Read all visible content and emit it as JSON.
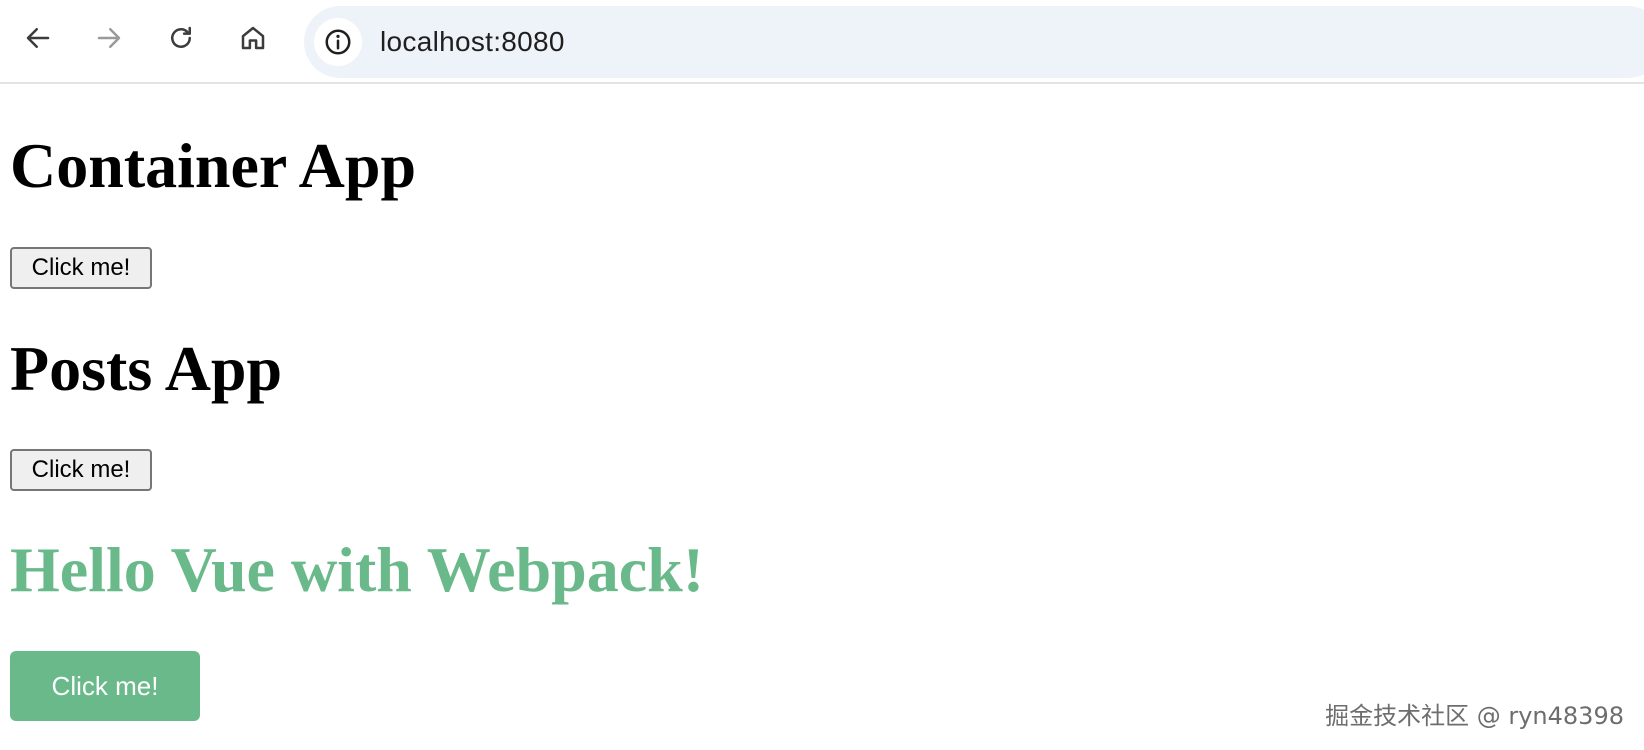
{
  "browser": {
    "url": "localhost:8080",
    "icons": {
      "back": "arrow-left-icon",
      "forward": "arrow-right-icon",
      "reload": "reload-icon",
      "home": "home-icon",
      "site_info": "info-icon"
    }
  },
  "page": {
    "container_app": {
      "title": "Container App",
      "button_label": "Click me!"
    },
    "posts_app": {
      "title": "Posts App",
      "button_label": "Click me!"
    },
    "vue_app": {
      "title": "Hello Vue with Webpack!",
      "button_label": "Click me!",
      "accent_color": "#6ab98a"
    }
  },
  "watermark": {
    "text": "掘金技术社区 @ ryn48398"
  }
}
